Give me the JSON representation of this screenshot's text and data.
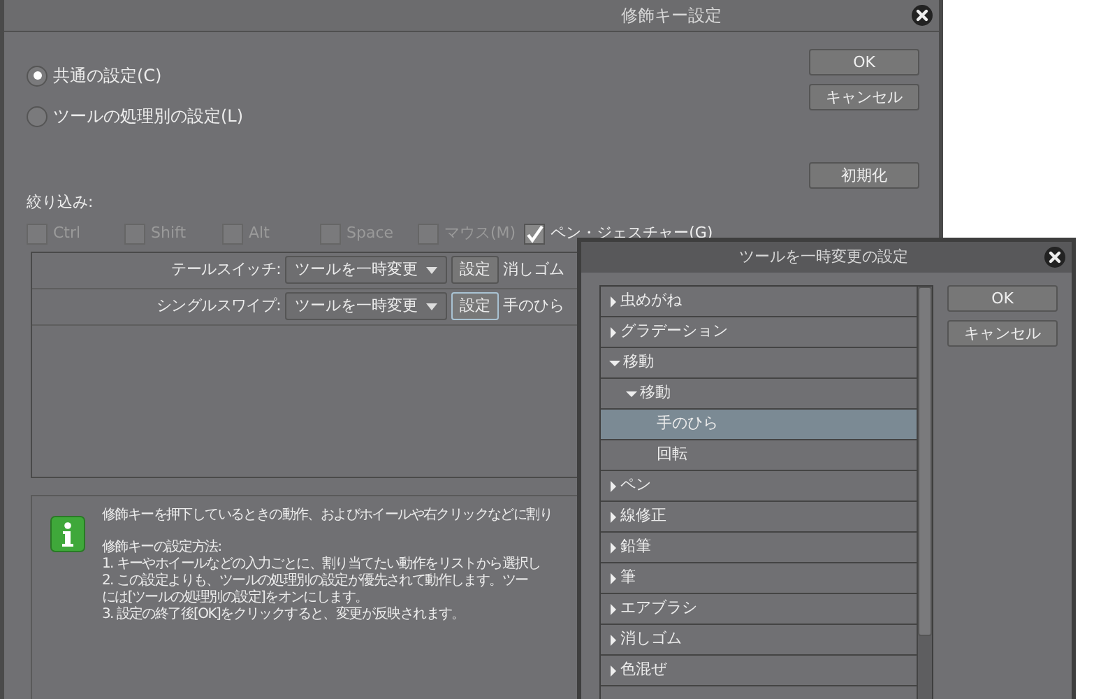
{
  "main_dialog": {
    "title": "修飾キー設定",
    "options": [
      {
        "label": "共通の設定(C)",
        "selected": true
      },
      {
        "label": "ツールの処理別の設定(L)",
        "selected": false
      }
    ],
    "buttons": [
      "OK",
      "キャンセル"
    ],
    "reset_button": "初期化",
    "filter": {
      "label": "絞り込み:",
      "checkboxes": [
        {
          "label": "Ctrl",
          "checked": false,
          "disabled": true
        },
        {
          "label": "Shift",
          "checked": false,
          "disabled": true
        },
        {
          "label": "Alt",
          "checked": false,
          "disabled": true
        },
        {
          "label": "Space",
          "checked": false,
          "disabled": true
        },
        {
          "label": "マウス(M)",
          "checked": false,
          "disabled": true
        },
        {
          "label": "ペン・ジェスチャー(G)",
          "checked": true,
          "disabled": false
        }
      ]
    },
    "assignments": [
      {
        "label": "テールスイッチ:",
        "action": "ツールを一時変更",
        "button": "設定",
        "focused": false,
        "tool": "消しゴム"
      },
      {
        "label": "シングルスワイプ:",
        "action": "ツールを一時変更",
        "button": "設定",
        "focused": true,
        "tool": "手のひら"
      }
    ],
    "info": {
      "paragraphs": [
        [
          "修飾キーを押下しているときの動作、およびホイールや右クリックなどに割り"
        ],
        [
          "修飾キーの設定方法:",
          "1. キーやホイールなどの入力ごとに、割り当てたい動作をリストから選択し",
          "2. この設定よりも、ツールの処理別の設定が優先されて動作します。ツー",
          "には[ツールの処理別の設定]をオンにします。",
          "3. 設定の終了後[OK]をクリックすると、変更が反映されます。"
        ]
      ]
    }
  },
  "tool_dialog": {
    "title": "ツールを一時変更の設定",
    "buttons": [
      "OK",
      "キャンセル"
    ],
    "tree": [
      {
        "label": "虫めがね",
        "kind": "folder",
        "expanded": false,
        "selected": false
      },
      {
        "label": "グラデーション",
        "kind": "folder",
        "expanded": false,
        "selected": false
      },
      {
        "label": "移動",
        "kind": "folder",
        "expanded": true,
        "selected": false,
        "children": [
          {
            "label": "移動",
            "kind": "folder",
            "expanded": true,
            "selected": false,
            "children": [
              {
                "label": "手のひら",
                "kind": "tool",
                "selected": true
              },
              {
                "label": "回転",
                "kind": "tool",
                "selected": false
              }
            ]
          }
        ]
      },
      {
        "label": "ペン",
        "kind": "folder",
        "expanded": false,
        "selected": false
      },
      {
        "label": "線修正",
        "kind": "folder",
        "expanded": false,
        "selected": false
      },
      {
        "label": "鉛筆",
        "kind": "folder",
        "expanded": false,
        "selected": false
      },
      {
        "label": "筆",
        "kind": "folder",
        "expanded": false,
        "selected": false
      },
      {
        "label": "エアブラシ",
        "kind": "folder",
        "expanded": false,
        "selected": false
      },
      {
        "label": "消しゴム",
        "kind": "folder",
        "expanded": false,
        "selected": false
      },
      {
        "label": "色混ぜ",
        "kind": "folder",
        "expanded": false,
        "selected": false
      }
    ]
  }
}
